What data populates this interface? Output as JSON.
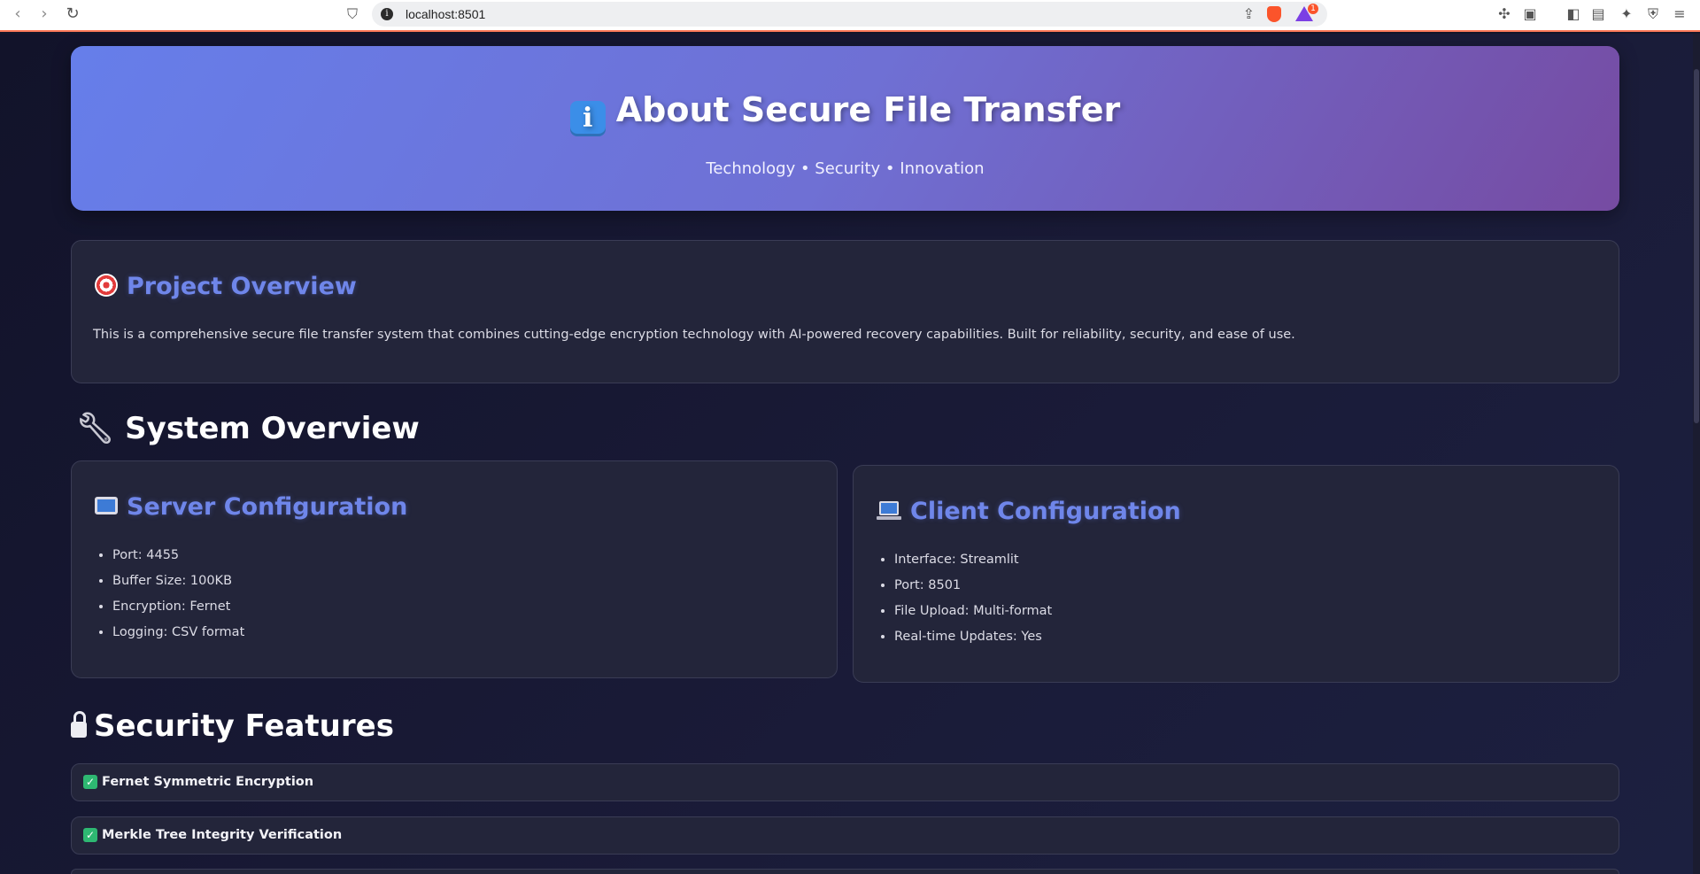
{
  "browser": {
    "url": "localhost:8501",
    "rewards_badge": "1"
  },
  "hero": {
    "title": "About Secure File Transfer",
    "subtitle": "Technology • Security • Innovation"
  },
  "overview": {
    "title": "Project Overview",
    "text": "This is a comprehensive secure file transfer system that combines cutting-edge encryption technology with AI-powered recovery capabilities. Built for reliability, security, and ease of use."
  },
  "system_overview": {
    "title": "System Overview",
    "server": {
      "title": "Server Configuration",
      "items": [
        "Port: 4455",
        "Buffer Size: 100KB",
        "Encryption: Fernet",
        "Logging: CSV format"
      ]
    },
    "client": {
      "title": "Client Configuration",
      "items": [
        "Interface: Streamlit",
        "Port: 8501",
        "File Upload: Multi-format",
        "Real-time Updates: Yes"
      ]
    }
  },
  "security": {
    "title": "Security Features",
    "features": [
      "Fernet Symmetric Encryption",
      "Merkle Tree Integrity Verification"
    ]
  },
  "icons": {
    "info": "info-icon",
    "target": "target-icon",
    "wrench": "wrench-icon",
    "server": "desktop-computer-icon",
    "client": "laptop-icon",
    "lock": "lock-icon",
    "check": "checkmark-icon"
  },
  "colors": {
    "hero_start": "#667eea",
    "hero_end": "#764ba2",
    "accent": "#6f86ea",
    "card_bg": "#23253a",
    "page_bg": "#15162a",
    "check": "#2eb872"
  }
}
